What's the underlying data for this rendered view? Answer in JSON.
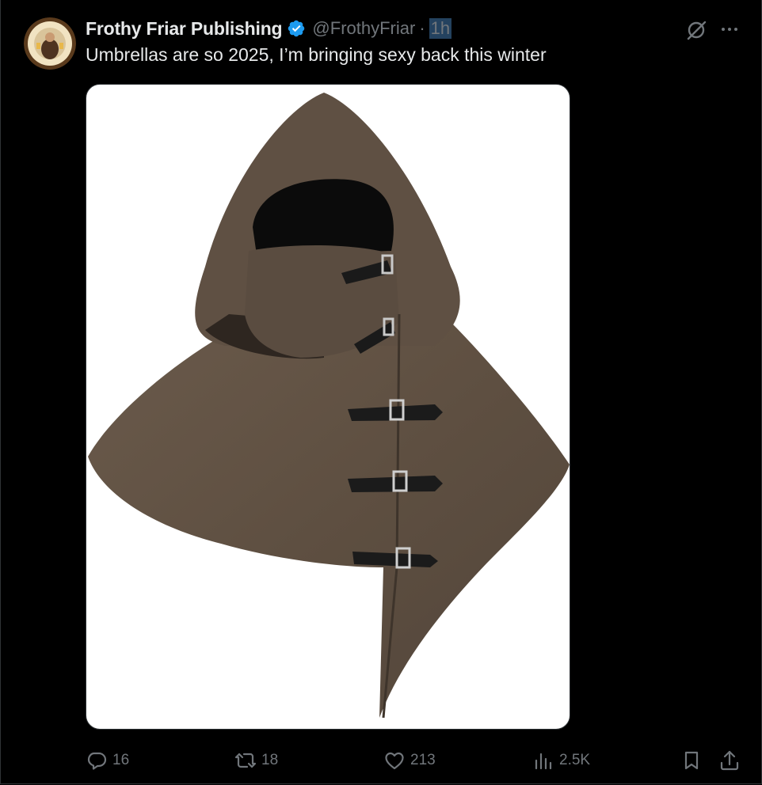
{
  "post": {
    "author_name": "Frothy Friar Publishing",
    "handle": "@FrothyFriar",
    "separator": "·",
    "time": "1h",
    "text": "Umbrellas are so 2025, I’m bringing sexy back this winter",
    "verified": true
  },
  "image": {
    "subject": "brown-hooded-cowl-with-buckles"
  },
  "actions": {
    "replies": "16",
    "reposts": "18",
    "likes": "213",
    "views": "2.5K"
  },
  "colors": {
    "background": "#000000",
    "text_primary": "#e7e9ea",
    "text_secondary": "#71767b",
    "verified_blue": "#1d9bf0",
    "selection": "#24425f"
  },
  "icons": [
    "reply-icon",
    "repost-icon",
    "like-icon",
    "views-icon",
    "bookmark-icon",
    "share-icon",
    "grok-icon",
    "more-icon",
    "verified-badge-icon"
  ]
}
